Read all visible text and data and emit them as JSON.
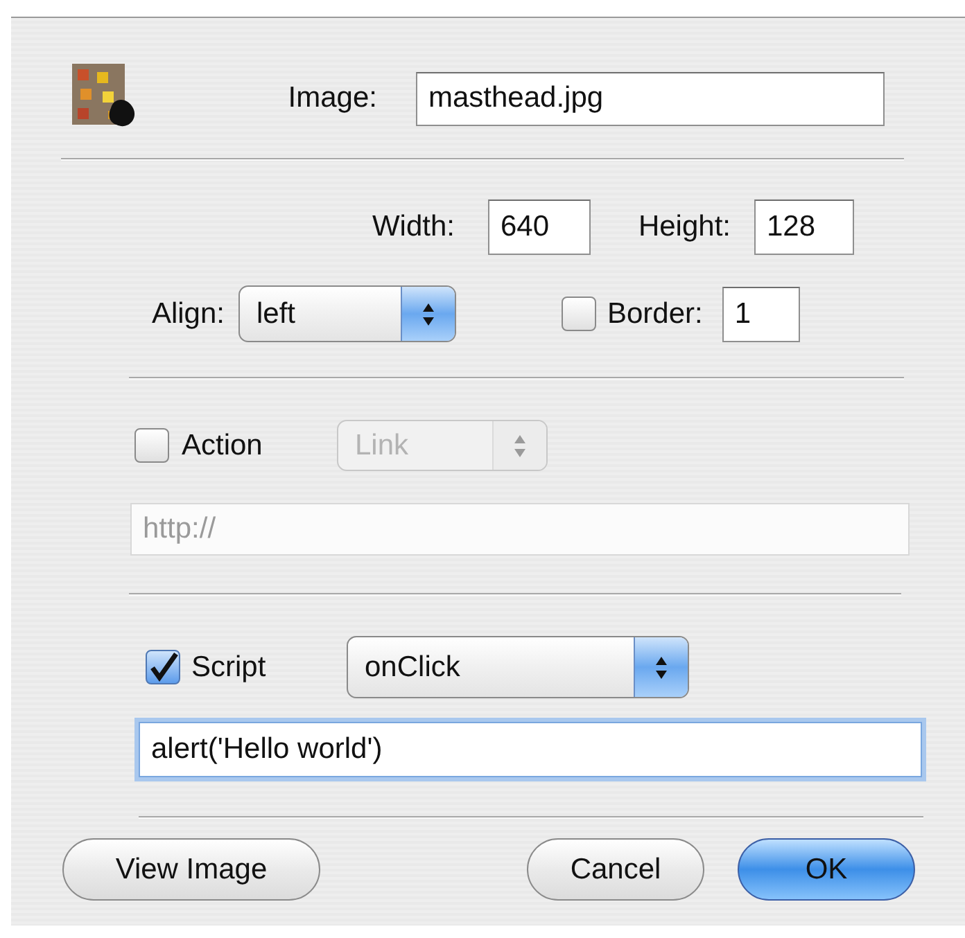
{
  "image": {
    "label": "Image:",
    "value": "masthead.jpg"
  },
  "width": {
    "label": "Width:",
    "value": "640"
  },
  "height": {
    "label": "Height:",
    "value": "128"
  },
  "align": {
    "label": "Align:",
    "value": "left"
  },
  "border": {
    "label": "Border:",
    "checked": false,
    "value": "1"
  },
  "action": {
    "label": "Action",
    "checked": false,
    "type": {
      "value": "Link",
      "disabled": true
    },
    "url": {
      "placeholder": "http://",
      "disabled": true
    }
  },
  "script": {
    "label": "Script",
    "checked": true,
    "event": "onClick",
    "code": {
      "value": "alert('Hello world')",
      "focused": true
    }
  },
  "buttons": [
    {
      "label": "View Image",
      "default": false
    },
    {
      "label": "Cancel",
      "default": false
    },
    {
      "label": "OK",
      "default": true
    }
  ]
}
